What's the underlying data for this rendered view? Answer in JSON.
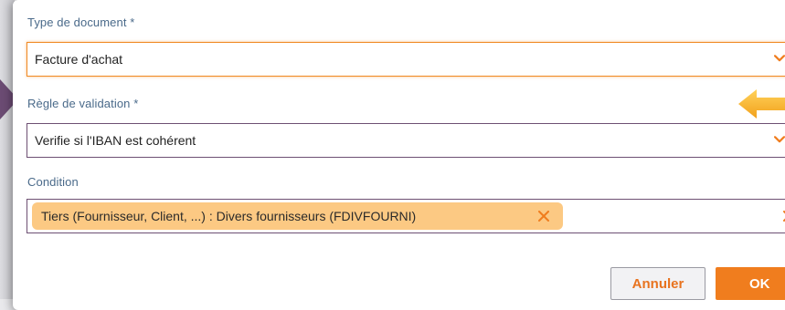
{
  "form": {
    "doc_type": {
      "label": "Type de document *",
      "value": "Facture d'achat"
    },
    "validation_rule": {
      "label": "Règle de validation *",
      "value": "Verifie si l'IBAN est cohérent"
    },
    "condition": {
      "label": "Condition",
      "chip_text": "Tiers (Fournisseur, Client, ...) : Divers fournisseurs (FDIVFOURNI)"
    }
  },
  "buttons": {
    "cancel_label": "Annuler",
    "ok_label": "OK"
  },
  "colors": {
    "accent_orange": "#f07d1e",
    "chip_bg": "#fcc983",
    "label_blue": "#4a6a8a",
    "field_border_purple": "#6d4f73",
    "annotation_arrow": "#f5a623"
  },
  "icons": {
    "dropdown": "chevron-down-icon",
    "remove_chip": "close-icon",
    "clear_field": "close-icon",
    "annotation": "arrow-left-icon"
  }
}
